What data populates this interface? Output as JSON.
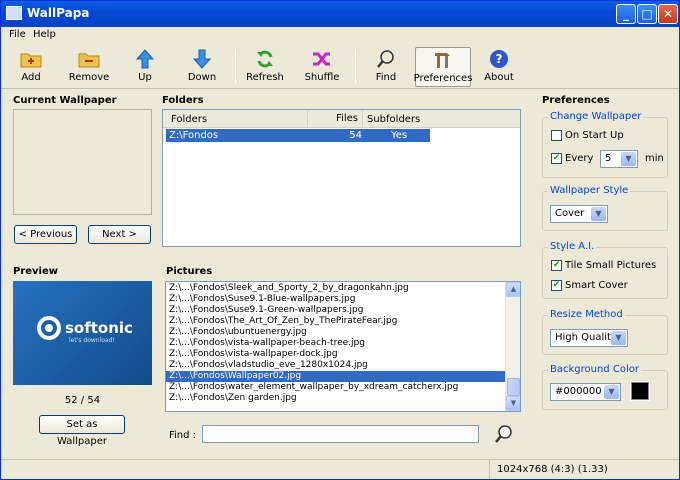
{
  "window": {
    "title": "WallPapa",
    "min": "_",
    "max": "□",
    "close": "✕"
  },
  "menu": [
    "File",
    "Help"
  ],
  "toolbar": {
    "add": "Add",
    "remove": "Remove",
    "up": "Up",
    "down": "Down",
    "refresh": "Refresh",
    "shuffle": "Shuffle",
    "find": "Find",
    "preferences": "Preferences",
    "about": "About"
  },
  "current": {
    "title": "Current Wallpaper",
    "prev": "< Previous",
    "next": "Next >"
  },
  "folders": {
    "title": "Folders",
    "headers": [
      "Folders",
      "Files",
      "Subfolders"
    ],
    "rows": [
      {
        "folder": "Z:\\Fondos",
        "files": "54",
        "sub": "Yes"
      }
    ]
  },
  "preview": {
    "title": "Preview",
    "logo": "softonic",
    "tagline": "let's download!",
    "counter": "52 / 54",
    "set_button": "Set as Wallpaper"
  },
  "pictures": {
    "title": "Pictures",
    "items": [
      "Z:\\...\\Fondos\\Sleek_and_Sporty_2_by_dragonkahn.jpg",
      "Z:\\...\\Fondos\\Suse9.1-Blue-wallpapers.jpg",
      "Z:\\...\\Fondos\\Suse9.1-Green-wallpapers.jpg",
      "Z:\\...\\Fondos\\The_Art_Of_Zen_by_ThePirateFear.jpg",
      "Z:\\...\\Fondos\\ubuntuenergy.jpg",
      "Z:\\...\\Fondos\\vista-wallpaper-beach-tree.jpg",
      "Z:\\...\\Fondos\\vista-wallpaper-dock.jpg",
      "Z:\\...\\Fondos\\vladstudio_eve_1280x1024.jpg",
      "Z:\\...\\Fondos\\Wallpaper02.jpg",
      "Z:\\...\\Fondos\\water_element_wallpaper_by_xdream_catcherx.jpg",
      "Z:\\...\\Fondos\\Zen garden.jpg"
    ],
    "selected_index": 8,
    "find_label": "Find :",
    "find_value": ""
  },
  "prefs": {
    "title": "Preferences",
    "change": {
      "title": "Change Wallpaper",
      "startup": "On Start Up",
      "startup_checked": false,
      "every": "Every",
      "every_checked": true,
      "every_value": "5",
      "unit": "min"
    },
    "style": {
      "title": "Wallpaper Style",
      "value": "Cover"
    },
    "ai": {
      "title": "Style A.I.",
      "tile": "Tile Small Pictures",
      "tile_checked": true,
      "smart": "Smart Cover",
      "smart_checked": true
    },
    "resize": {
      "title": "Resize Method",
      "value": "High Quality"
    },
    "bg": {
      "title": "Background Color",
      "value": "#000000",
      "swatch": "#000000"
    }
  },
  "status": {
    "info": "1024x768 (4:3) (1.33)"
  },
  "colors": {
    "selection": "#316ac5",
    "group_label": "#0046d5",
    "preview_bg": "#1b5fa8"
  }
}
